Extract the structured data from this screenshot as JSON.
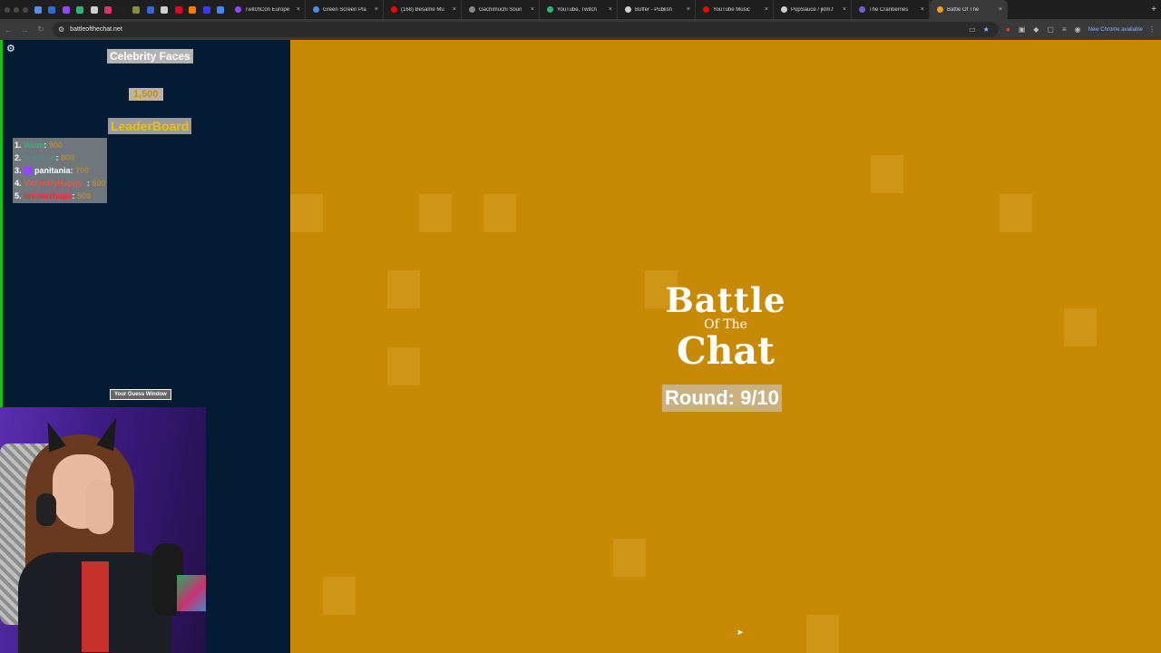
{
  "browser": {
    "tabs": [
      {
        "title": "TwitchCon Europe",
        "color": "#9146ff"
      },
      {
        "title": "Green Screen Pla",
        "color": "#4a90e2"
      },
      {
        "title": "(168) Besame Mu",
        "color": "#ff0000"
      },
      {
        "title": "Gachimuchi Soun",
        "color": "#888888"
      },
      {
        "title": "YouTube, Twitch",
        "color": "#2bb673"
      },
      {
        "title": "Buffer - Publish",
        "color": "#cfcfcf"
      },
      {
        "title": "YouTube Music",
        "color": "#ff0000"
      },
      {
        "title": "PopSauce / jklm.f",
        "color": "#cfcfcf"
      },
      {
        "title": "The Cranberries",
        "color": "#7d5bd6"
      },
      {
        "title": "Battle Of The",
        "color": "#f0a020"
      }
    ],
    "pinned_colors": [
      "#5a8dee",
      "#2c6bd8",
      "#9146ff",
      "#2bb673",
      "#cfcfcf",
      "#e1306c",
      "#222222",
      "#8b8b3a",
      "#3a64d8",
      "#cfcfcf",
      "#e60023",
      "#ff7a00",
      "#3a3aff",
      "#4285f4"
    ],
    "url": "battleofthechat.net",
    "new_chrome_label": "New Chrome available"
  },
  "sidebar": {
    "category": "Celebrity Faces",
    "score_badge": "1,500",
    "leaderboard_title": "LeaderBoard",
    "guess_window_label": "Your Guess Window",
    "leaderboard": [
      {
        "rank": "1.",
        "name": "Wrim",
        "points": "900",
        "color": "#2bb673"
      },
      {
        "rank": "2.",
        "name": "Noob_ai",
        "points": "800",
        "color": "#5a8a8a"
      },
      {
        "rank": "3.",
        "name": "panitania",
        "points": "700",
        "color": "#ffffff"
      },
      {
        "rank": "4.",
        "name": "ViolentlyHappy_",
        "points": "600",
        "color": "#e2584a"
      },
      {
        "rank": "5.",
        "name": "invokerhope",
        "points": "500",
        "color": "#ff2a1f"
      }
    ]
  },
  "stage": {
    "logo_line1": "Battle",
    "logo_line2": "Of The",
    "logo_line3": "Chat",
    "round_label": "Round: 9/10"
  }
}
